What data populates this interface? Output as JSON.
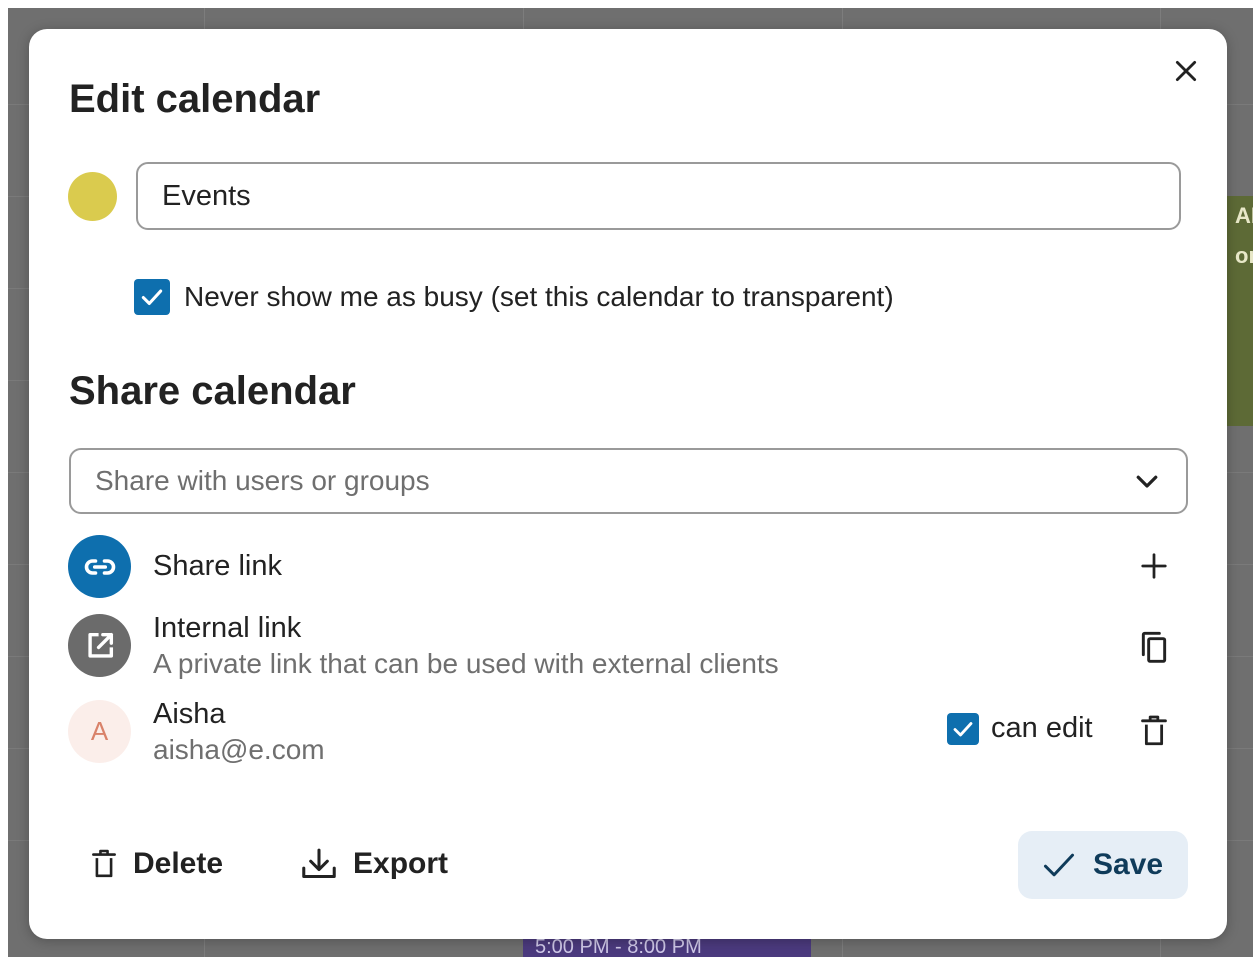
{
  "background": {
    "event_green_text": "AM\nor",
    "event_purple_text": "5:00 PM - 8:00 PM"
  },
  "dialog": {
    "title": "Edit calendar",
    "calendar_color": "#dacb4e",
    "calendar_name": "Events",
    "transparent_checked": true,
    "transparent_label": "Never show me as busy (set this calendar to transparent)"
  },
  "share": {
    "title": "Share calendar",
    "search_placeholder": "Share with users or groups",
    "share_link_label": "Share link",
    "internal_link_label": "Internal link",
    "internal_link_description": "A private link that can be used with external clients",
    "shares": [
      {
        "initial": "A",
        "name": "Aisha",
        "email": "aisha@e.com",
        "can_edit_checked": true,
        "permission_label": "can edit"
      }
    ]
  },
  "footer": {
    "delete_label": "Delete",
    "export_label": "Export",
    "save_label": "Save"
  },
  "colors": {
    "primary": "#0e6fae",
    "internal_link_avatar": "#6b6b6b",
    "user_avatar_bg": "#fbeeea",
    "user_avatar_text": "#d9826a",
    "save_bg": "#e6eef6"
  },
  "icons": {
    "close": "close-icon",
    "dropdown": "chevron-down-icon",
    "share_link": "link-icon",
    "internal_link": "open-in-new-icon",
    "add": "plus-icon",
    "copy": "copy-icon",
    "remove": "trash-icon",
    "delete": "trash-icon",
    "export": "download-icon",
    "save": "check-icon"
  }
}
